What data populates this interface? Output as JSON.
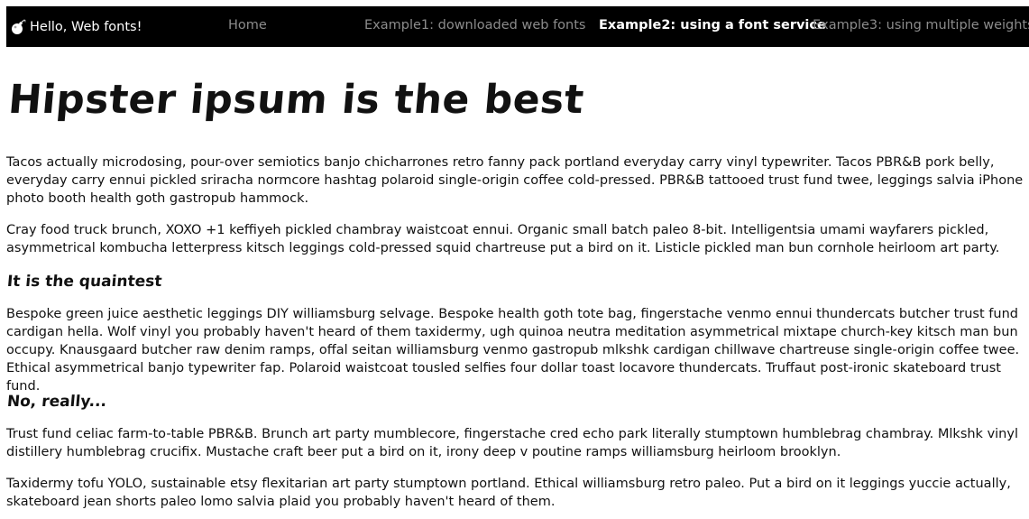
{
  "navbar": {
    "brand": {
      "icon": "bomb-icon",
      "label": "Hello, Web fonts!"
    },
    "links": [
      {
        "label": "Home",
        "active": false
      },
      {
        "label": "Example1: downloaded web fonts",
        "active": false
      },
      {
        "label": "Example2: using a font service",
        "active": true
      },
      {
        "label": "Example3: using multiple weights",
        "active": false
      }
    ]
  },
  "content": {
    "title": "Hipster ipsum is the best",
    "paragraph_1": "Tacos actually microdosing, pour-over semiotics banjo chicharrones retro fanny pack portland everyday carry vinyl typewriter. Tacos PBR&B pork belly, everyday carry ennui pickled sriracha normcore hashtag polaroid single-origin coffee cold-pressed. PBR&B tattooed trust fund twee, leggings salvia iPhone photo booth health goth gastropub hammock.",
    "paragraph_2": "Cray food truck brunch, XOXO +1 keffiyeh pickled chambray waistcoat ennui. Organic small batch paleo 8-bit. Intelligentsia umami wayfarers pickled, asymmetrical kombucha letterpress kitsch leggings cold-pressed squid chartreuse put a bird on it. Listicle pickled man bun cornhole heirloom art party.",
    "heading_1": "It is the quaintest",
    "paragraph_3": "Bespoke green juice aesthetic leggings DIY williamsburg selvage. Bespoke health goth tote bag, fingerstache venmo ennui thundercats butcher trust fund cardigan hella. Wolf vinyl you probably haven't heard of them taxidermy, ugh quinoa neutra meditation asymmetrical mixtape church-key kitsch man bun occupy. Knausgaard butcher raw denim ramps, offal seitan williamsburg venmo gastropub mlkshk cardigan chillwave chartreuse single-origin coffee twee. Ethical asymmetrical banjo typewriter fap. Polaroid waistcoat tousled selfies four dollar toast locavore thundercats. Truffaut post-ironic skateboard trust fund.",
    "heading_2": "No, really...",
    "paragraph_4": "Trust fund celiac farm-to-table PBR&B. Brunch art party mumblecore, fingerstache cred echo park literally stumptown humblebrag chambray. Mlkshk vinyl distillery humblebrag crucifix. Mustache craft beer put a bird on it, irony deep v poutine ramps williamsburg heirloom brooklyn.",
    "paragraph_5": "Taxidermy tofu YOLO, sustainable etsy flexitarian art party stumptown portland. Ethical williamsburg retro paleo. Put a bird on it leggings yuccie actually, skateboard jean shorts paleo lomo salvia plaid you probably haven't heard of them."
  },
  "colors": {
    "navbar_bg": "#000000",
    "nav_link": "#8c8c8c",
    "nav_link_active": "#ffffff",
    "text": "#111111"
  }
}
